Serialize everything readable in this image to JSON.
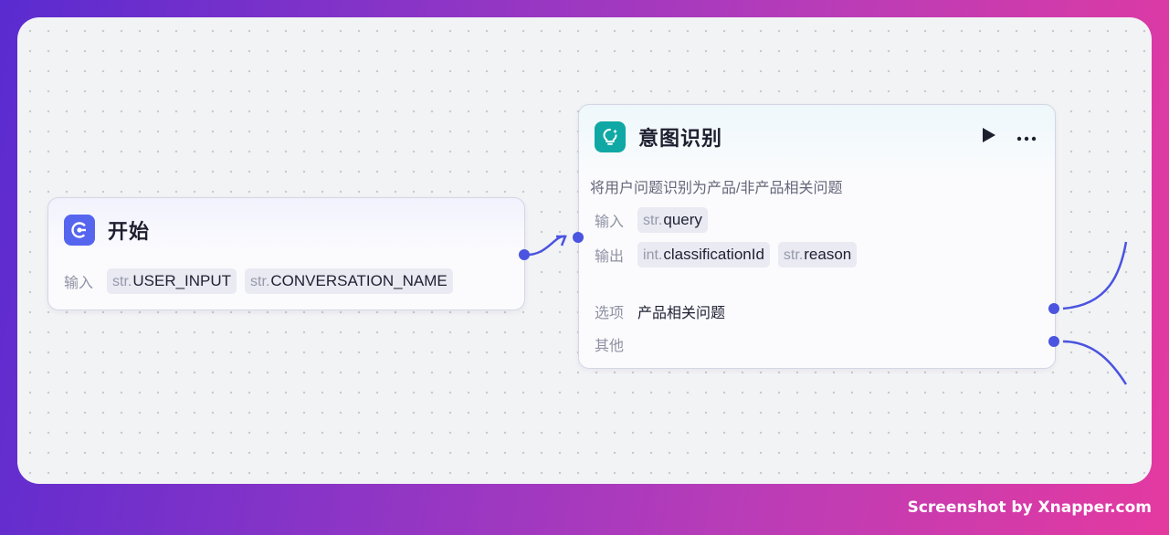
{
  "start_node": {
    "title": "开始",
    "input_label": "输入",
    "inputs": [
      {
        "type": "str.",
        "name": "USER_INPUT"
      },
      {
        "type": "str.",
        "name": "CONVERSATION_NAME"
      }
    ]
  },
  "intent_node": {
    "title": "意图识别",
    "description": "将用户问题识别为产品/非产品相关问题",
    "input_label": "输入",
    "inputs": [
      {
        "type": "str.",
        "name": "query"
      }
    ],
    "output_label": "输出",
    "outputs": [
      {
        "type": "int.",
        "name": "classificationId"
      },
      {
        "type": "str.",
        "name": "reason"
      }
    ],
    "options_label": "选项",
    "option_value": "产品相关问题",
    "other_label": "其他"
  },
  "icons": [
    "run-icon",
    "more-icon",
    "start-node-icon",
    "intent-node-icon"
  ],
  "colors": {
    "accent": "#4a54e0",
    "start_icon_bg": "#5665ee",
    "intent_icon_bg": "#10a8a4"
  },
  "watermark": "Screenshot by Xnapper.com"
}
